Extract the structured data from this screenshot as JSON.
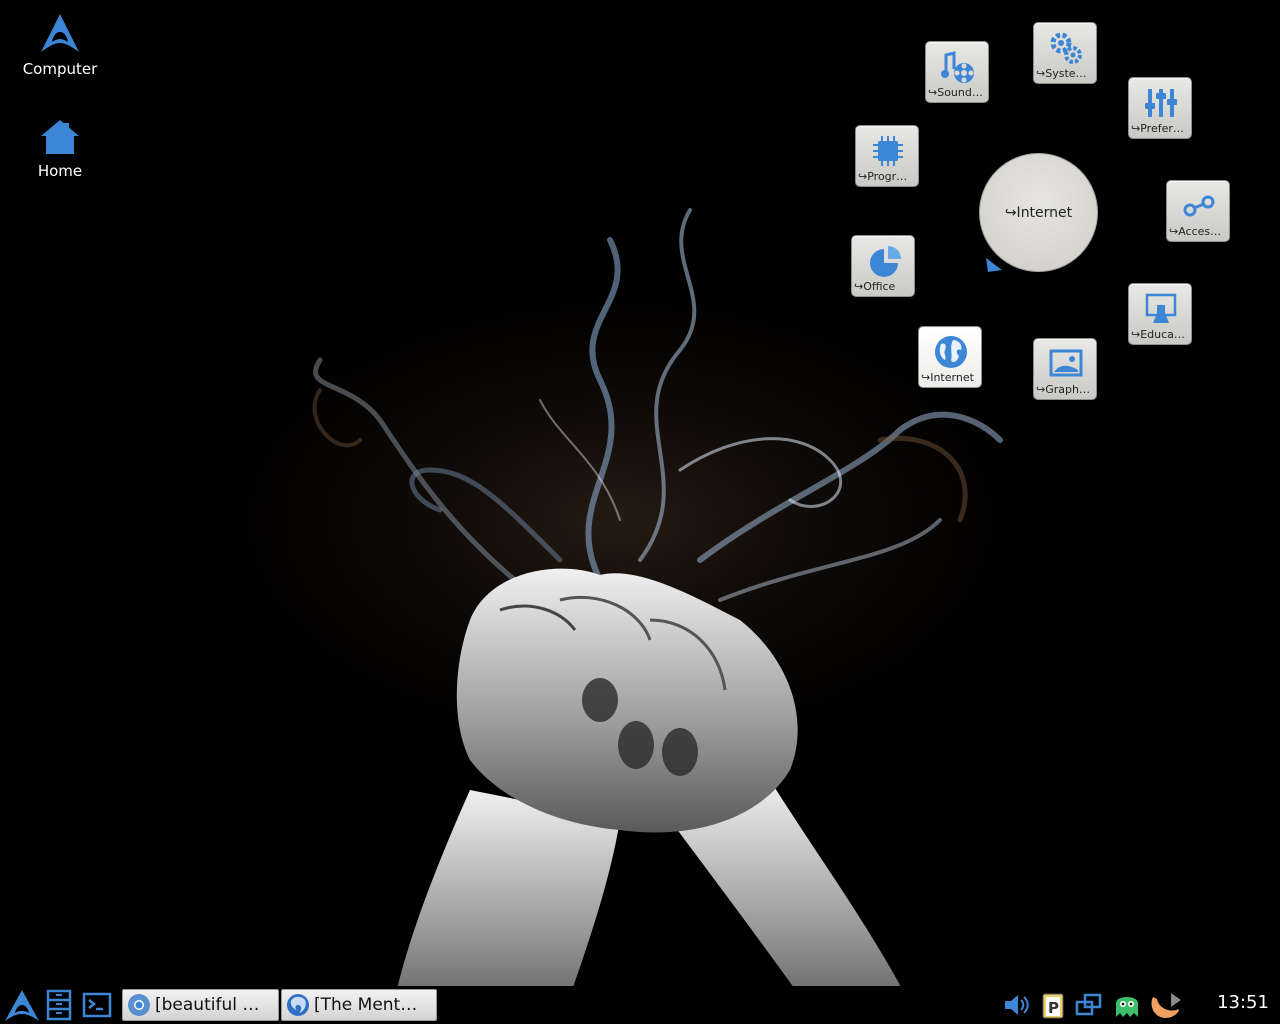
{
  "desktop": {
    "icons": [
      {
        "label": "Computer",
        "icon": "arch-logo-icon"
      },
      {
        "label": "Home",
        "icon": "home-icon"
      }
    ]
  },
  "radial_menu": {
    "center_label": "↪Internet",
    "items": [
      {
        "label": "↪Sound…",
        "icon": "sound-video-icon"
      },
      {
        "label": "↪Syste…",
        "icon": "gears-icon"
      },
      {
        "label": "↪Prefer…",
        "icon": "sliders-icon"
      },
      {
        "label": "↪Progr…",
        "icon": "chip-icon"
      },
      {
        "label": "↪Acces…",
        "icon": "accessories-icon"
      },
      {
        "label": "↪Office",
        "icon": "office-chart-icon"
      },
      {
        "label": "↪Educa…",
        "icon": "education-icon"
      },
      {
        "label": "↪Internet",
        "icon": "globe-icon"
      },
      {
        "label": "↪Graph…",
        "icon": "picture-icon"
      }
    ]
  },
  "taskbar": {
    "tasks": [
      {
        "label": "[beautiful …",
        "icon": "chromium-icon"
      },
      {
        "label": "[The Ment…",
        "icon": "firefox-icon"
      }
    ],
    "clock": "13:51"
  },
  "colors": {
    "accent": "#3d86d6",
    "tile_bg": "#dcdcd8",
    "taskbar_bg": "#000000"
  }
}
